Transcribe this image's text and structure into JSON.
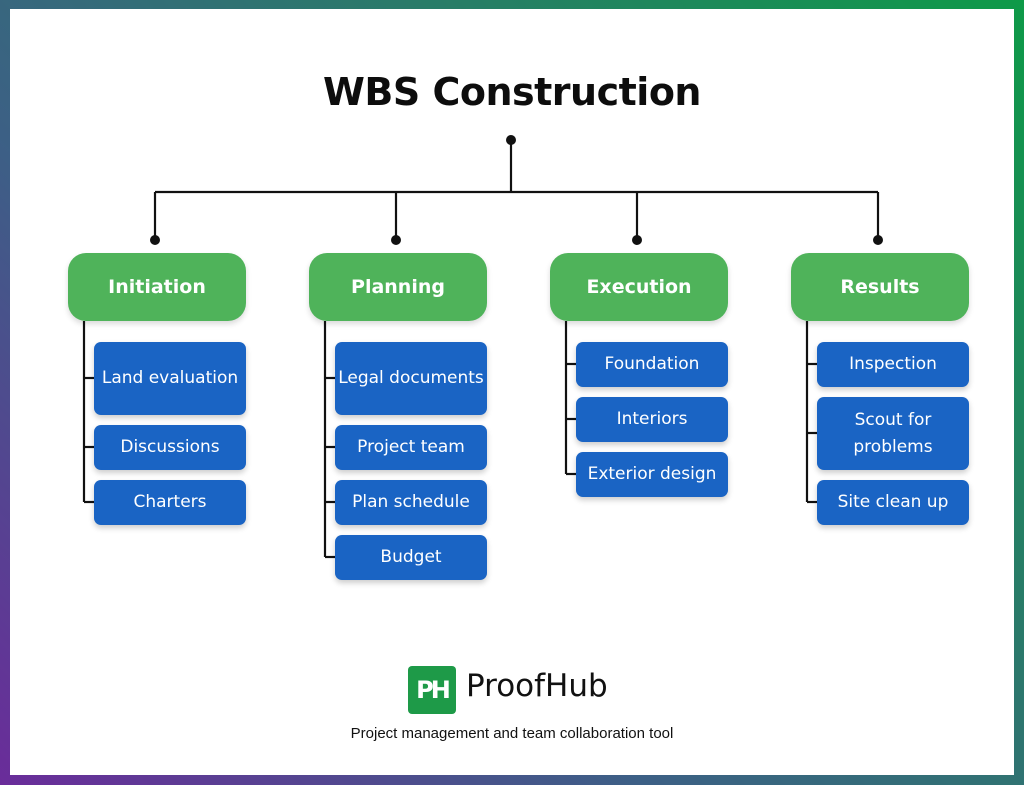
{
  "title": "WBS Construction",
  "colors": {
    "phase": "#4fb35a",
    "task": "#1a64c4",
    "connector": "#111111",
    "brand": "#1e9a48"
  },
  "phases": [
    {
      "label": "Initiation",
      "tasks": [
        "Land evaluation",
        "Discussions",
        "Charters"
      ]
    },
    {
      "label": "Planning",
      "tasks": [
        "Legal documents",
        "Project team",
        "Plan schedule",
        "Budget"
      ]
    },
    {
      "label": "Execution",
      "tasks": [
        "Foundation",
        "Interiors",
        "Exterior design"
      ]
    },
    {
      "label": "Results",
      "tasks": [
        "Inspection",
        "Scout for problems",
        "Site clean up"
      ]
    }
  ],
  "footer": {
    "logo_text": "PH",
    "brand": "ProofHub",
    "tagline": "Project management and team collaboration tool"
  }
}
